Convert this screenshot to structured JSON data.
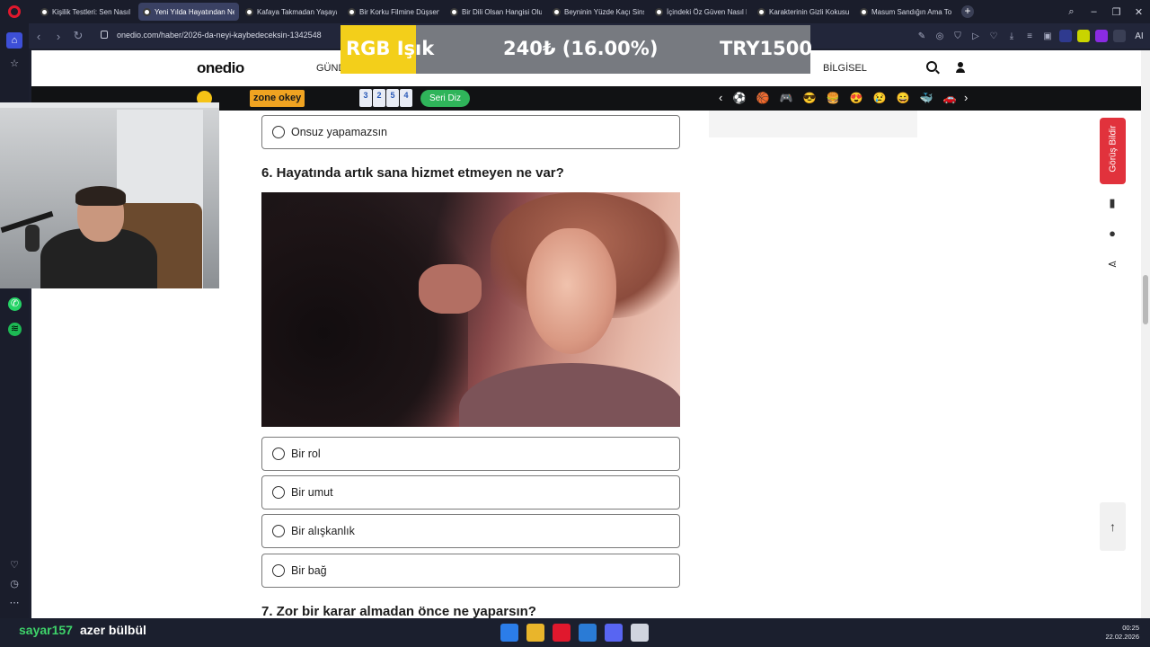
{
  "browser": {
    "tabs": [
      {
        "title": "Kişilik Testleri: Sen Nasıl B",
        "active": false
      },
      {
        "title": "Yeni Yılda Hayatından Ne",
        "active": true
      },
      {
        "title": "Kafaya Takmadan Yaşayab",
        "active": false
      },
      {
        "title": "Bir Korku Filmine Düşsen",
        "active": false
      },
      {
        "title": "Bir Dili Olsan Hangisi Olur",
        "active": false
      },
      {
        "title": "Beyninin Yüzde Kaçı Sinsil",
        "active": false
      },
      {
        "title": "İçindeki Öz Güven Nasıl B",
        "active": false
      },
      {
        "title": "Karakterinin Gizli Kokusu",
        "active": false
      },
      {
        "title": "Masum Sandığın Ama Tok",
        "active": false
      }
    ],
    "new_tab": "+",
    "url": "onedio.com/haber/2026-da-neyi-kaybedeceksin-1342548",
    "ai_label": "AI",
    "ext_colors": [
      "#2f3a8f",
      "#c9d400",
      "#8a2be2",
      "#3a3f55"
    ]
  },
  "site": {
    "logo": "onedio",
    "nav_gundem": "GÜND",
    "nav_bilgisel": "BİLGİSEL",
    "promo": {
      "zoneokey": "zone okey",
      "tiles": [
        "3",
        "2",
        "5",
        "4"
      ],
      "seri_diz": "Seri Diz"
    },
    "category_icons": [
      "⚽",
      "🏀",
      "🎮",
      "😎",
      "🍔",
      "😍",
      "😢",
      "😄",
      "🐳",
      "🚗"
    ]
  },
  "ad": {
    "brand": "RGB Işık",
    "price": "240₺ (16.00%)",
    "amount": "TRY1500"
  },
  "quiz": {
    "prev_option": "Onsuz yapamazsın",
    "q6_title": "6. Hayatında artık sana hizmet etmeyen ne var?",
    "q6_options": [
      "Bir rol",
      "Bir umut",
      "Bir alışkanlık",
      "Bir bağ"
    ],
    "q7_title": "7. Zor bir karar almadan önce ne yaparsın?"
  },
  "feedback": {
    "label": "Görüş Bildir"
  },
  "stream": {
    "chat_user": "sayar157",
    "chat_message": "azer bülbül"
  },
  "taskbar": {
    "time": "00:25",
    "date": "22.02.2026",
    "icon_colors": [
      "#2b7de9",
      "#e9b52b",
      "#e0182d",
      "#2a7bd6",
      "#5865f2",
      "#d0d4de"
    ]
  }
}
